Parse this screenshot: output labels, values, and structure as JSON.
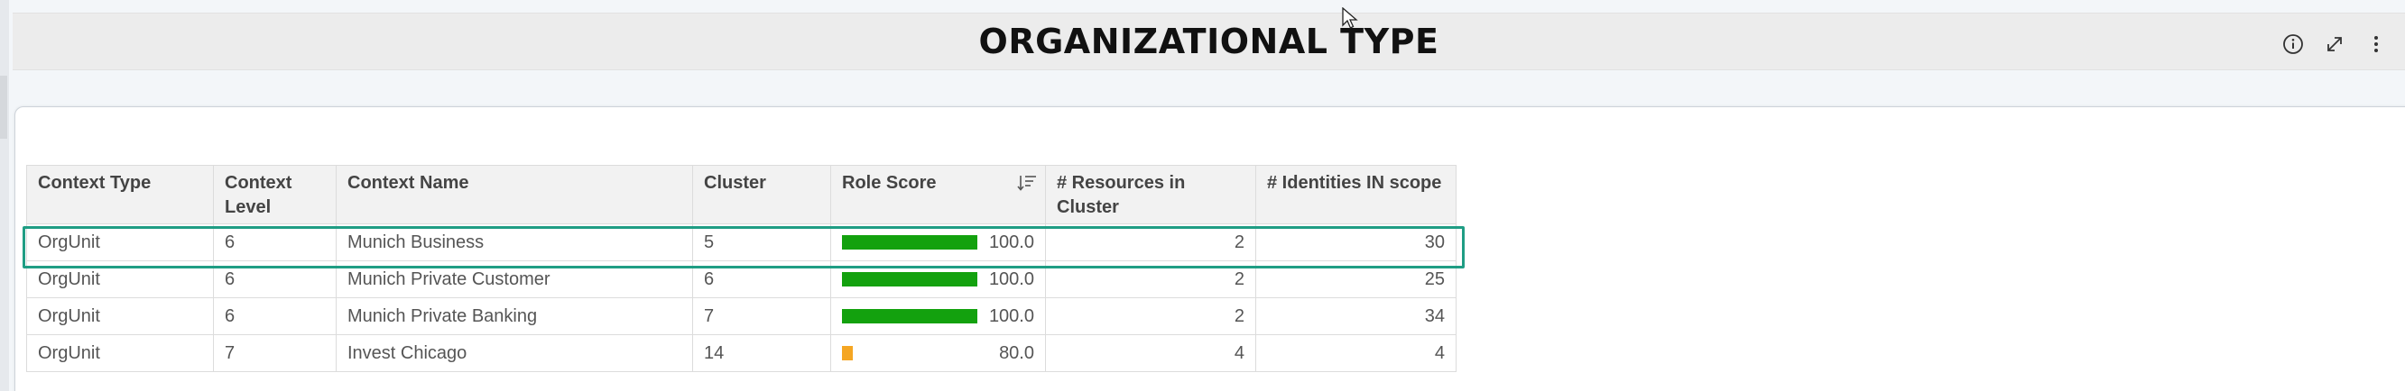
{
  "header": {
    "title": "ORGANIZATIONAL TYPE",
    "icons": [
      "info-icon",
      "expand-icon",
      "more-vertical-icon"
    ]
  },
  "table": {
    "columns": [
      "Context Type",
      "Context Level",
      "Context Name",
      "Cluster",
      "Role Score",
      "# Resources in Cluster",
      "# Identities IN scope"
    ],
    "sorted_column": "Role Score",
    "rows": [
      {
        "context_type": "OrgUnit",
        "context_level": "6",
        "context_name": "Munich Business",
        "cluster": "5",
        "role_score": "100.0",
        "score_fraction": 1.0,
        "score_color": "#13a10e",
        "resources": "2",
        "identities": "30",
        "selected": true
      },
      {
        "context_type": "OrgUnit",
        "context_level": "6",
        "context_name": "Munich Private Customer",
        "cluster": "6",
        "role_score": "100.0",
        "score_fraction": 1.0,
        "score_color": "#13a10e",
        "resources": "2",
        "identities": "25",
        "selected": false
      },
      {
        "context_type": "OrgUnit",
        "context_level": "6",
        "context_name": "Munich Private Banking",
        "cluster": "7",
        "role_score": "100.0",
        "score_fraction": 1.0,
        "score_color": "#13a10e",
        "resources": "2",
        "identities": "34",
        "selected": false
      },
      {
        "context_type": "OrgUnit",
        "context_level": "7",
        "context_name": "Invest Chicago",
        "cluster": "14",
        "role_score": "80.0",
        "score_fraction": 0.08,
        "score_color": "#f5a623",
        "resources": "4",
        "identities": "4",
        "selected": false
      }
    ]
  },
  "colors": {
    "highlight_border": "#1f9d84",
    "bar_green": "#13a10e",
    "bar_orange": "#f5a623"
  }
}
